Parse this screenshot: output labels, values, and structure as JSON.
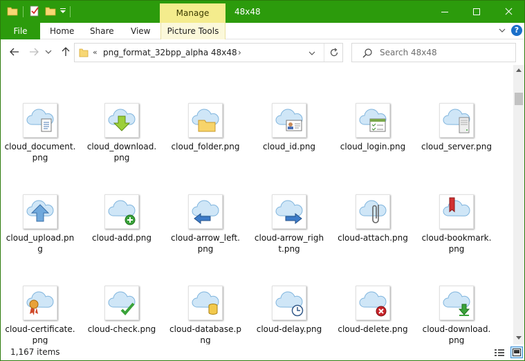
{
  "titlebar": {
    "manage_tab": "Manage",
    "title": "48x48"
  },
  "ribbon": {
    "file": "File",
    "home": "Home",
    "share": "Share",
    "view": "View",
    "picture_tools": "Picture Tools",
    "help": "?"
  },
  "address": {
    "overflow": "«",
    "crumbs": [
      "png_format_32bpp_alpha",
      "48x48"
    ],
    "sep": "›"
  },
  "search": {
    "placeholder": "Search 48x48"
  },
  "items": [
    {
      "label": "cloud_document.png",
      "icon": "cloud-document-icon"
    },
    {
      "label": "cloud_download.png",
      "icon": "cloud-download-icon"
    },
    {
      "label": "cloud_folder.png",
      "icon": "cloud-folder-icon"
    },
    {
      "label": "cloud_id.png",
      "icon": "cloud-id-icon"
    },
    {
      "label": "cloud_login.png",
      "icon": "cloud-login-icon"
    },
    {
      "label": "cloud_server.png",
      "icon": "cloud-server-icon"
    },
    {
      "label": "cloud_upload.png",
      "icon": "cloud-upload-icon"
    },
    {
      "label": "cloud-add.png",
      "icon": "cloud-add-icon"
    },
    {
      "label": "cloud-arrow_left.png",
      "icon": "cloud-arrow-left-icon"
    },
    {
      "label": "cloud-arrow_right.png",
      "icon": "cloud-arrow-right-icon"
    },
    {
      "label": "cloud-attach.png",
      "icon": "cloud-attach-icon"
    },
    {
      "label": "cloud-bookmark.png",
      "icon": "cloud-bookmark-icon"
    },
    {
      "label": "cloud-certificate.png",
      "icon": "cloud-certificate-icon"
    },
    {
      "label": "cloud-check.png",
      "icon": "cloud-check-icon"
    },
    {
      "label": "cloud-database.png",
      "icon": "cloud-database-icon"
    },
    {
      "label": "cloud-delay.png",
      "icon": "cloud-delay-icon"
    },
    {
      "label": "cloud-delete.png",
      "icon": "cloud-delete-icon"
    },
    {
      "label": "cloud-download.png",
      "icon": "cloud-download-icon"
    }
  ],
  "status": {
    "count": "1,167 items"
  },
  "colors": {
    "accent": "#2c9b0c",
    "manage": "#f4ec8d"
  }
}
